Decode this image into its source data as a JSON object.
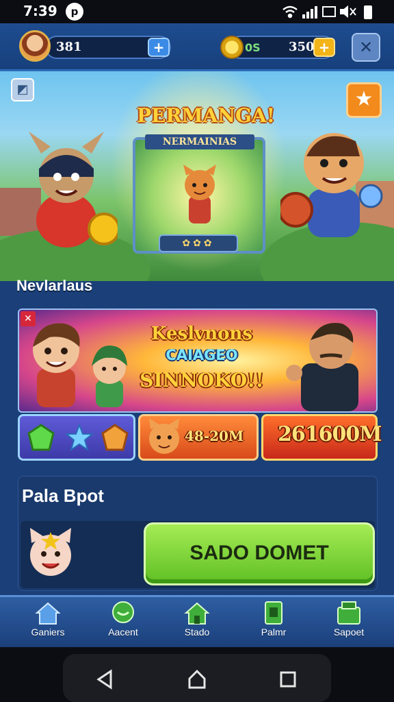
{
  "status_bar": {
    "time": "7:39",
    "app_indicator": "p"
  },
  "hud": {
    "level_value": "381",
    "coin_label": "0S",
    "coin_value": "350",
    "add_symbol": "+",
    "close_symbol": "✕"
  },
  "hero": {
    "title": "PERMANGA!",
    "subtitle": "NERMAINIAS"
  },
  "sections": {
    "news_title": "Nevlarlaus",
    "panel_title": "Pala Bpot"
  },
  "event": {
    "tag": "✕",
    "title": "Keslvnons",
    "subtitle": "CAIAGEO",
    "headline": "SINNOKO!!"
  },
  "rewards": {
    "pet_reward": "48-20M",
    "prize_reward": "261600M"
  },
  "primary_button": {
    "label": "SADO DOMET"
  },
  "tab_bar": {
    "items": [
      {
        "label": "Ganiers",
        "icon": "home-icon"
      },
      {
        "label": "Aacent",
        "icon": "chat-icon"
      },
      {
        "label": "Stado",
        "icon": "house-icon"
      },
      {
        "label": "Palmr",
        "icon": "card-icon"
      },
      {
        "label": "Sapoet",
        "icon": "shop-icon"
      }
    ]
  },
  "colors": {
    "accent_green": "#6fd02c",
    "coin_gold": "#f2b417",
    "primary_blue": "#1b3f78"
  }
}
